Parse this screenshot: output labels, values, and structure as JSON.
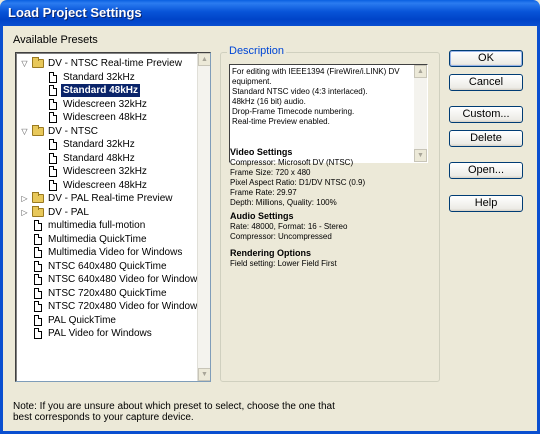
{
  "window": {
    "title": "Load Project Settings"
  },
  "presets": {
    "label": "Available Presets",
    "tree": [
      {
        "level": 0,
        "kind": "folder",
        "expanded": true,
        "label": "DV - NTSC Real-time Preview"
      },
      {
        "level": 1,
        "kind": "doc",
        "label": "Standard 32kHz"
      },
      {
        "level": 1,
        "kind": "doc",
        "label": "Standard 48kHz",
        "selected": true
      },
      {
        "level": 1,
        "kind": "doc",
        "label": "Widescreen 32kHz"
      },
      {
        "level": 1,
        "kind": "doc",
        "label": "Widescreen 48kHz"
      },
      {
        "level": 0,
        "kind": "folder",
        "expanded": true,
        "label": "DV - NTSC"
      },
      {
        "level": 1,
        "kind": "doc",
        "label": "Standard 32kHz"
      },
      {
        "level": 1,
        "kind": "doc",
        "label": "Standard 48kHz"
      },
      {
        "level": 1,
        "kind": "doc",
        "label": "Widescreen 32kHz"
      },
      {
        "level": 1,
        "kind": "doc",
        "label": "Widescreen 48kHz"
      },
      {
        "level": 0,
        "kind": "folder",
        "expanded": false,
        "label": "DV - PAL Real-time Preview"
      },
      {
        "level": 0,
        "kind": "folder",
        "expanded": false,
        "label": "DV - PAL"
      },
      {
        "level": 0,
        "kind": "doc",
        "label": "multimedia full-motion"
      },
      {
        "level": 0,
        "kind": "doc",
        "label": "Multimedia QuickTime"
      },
      {
        "level": 0,
        "kind": "doc",
        "label": "Multimedia Video for Windows"
      },
      {
        "level": 0,
        "kind": "doc",
        "label": "NTSC 640x480 QuickTime"
      },
      {
        "level": 0,
        "kind": "doc",
        "label": "NTSC 640x480 Video for Windows"
      },
      {
        "level": 0,
        "kind": "doc",
        "label": "NTSC 720x480 QuickTime"
      },
      {
        "level": 0,
        "kind": "doc",
        "label": "NTSC 720x480 Video for Windows"
      },
      {
        "level": 0,
        "kind": "doc",
        "label": "PAL QuickTime"
      },
      {
        "level": 0,
        "kind": "doc",
        "label": "PAL Video for Windows"
      }
    ]
  },
  "description": {
    "legend": "Description",
    "text": "For editing with IEEE1394 (FireWire/i.LINK) DV equipment.\nStandard NTSC video (4:3 interlaced).\n48kHz (16 bit) audio.\nDrop-Frame Timecode numbering.\nReal-time Preview enabled.",
    "video": {
      "heading": "Video Settings",
      "lines": [
        "Compressor: Microsoft DV (NTSC)",
        "Frame Size: 720 x 480",
        "Pixel Aspect Ratio: D1/DV NTSC (0.9)",
        "Frame Rate: 29.97",
        "Depth: Millions, Quality: 100%"
      ]
    },
    "audio": {
      "heading": "Audio Settings",
      "lines": [
        "Rate: 48000, Format: 16 - Stereo",
        "Compressor: Uncompressed"
      ]
    },
    "rendering": {
      "heading": "Rendering Options",
      "lines": [
        "Field setting: Lower Field First"
      ]
    }
  },
  "buttons": {
    "ok": "OK",
    "cancel": "Cancel",
    "custom": "Custom...",
    "delete": "Delete",
    "open": "Open...",
    "help": "Help"
  },
  "note": "Note: If you are unsure about which preset to select, choose the one that best corresponds to your capture device.",
  "colors": {
    "title_bar": "#0054E3",
    "selection": "#0A246A",
    "legend": "#0046D5",
    "dialog_bg": "#ECE9D8"
  }
}
